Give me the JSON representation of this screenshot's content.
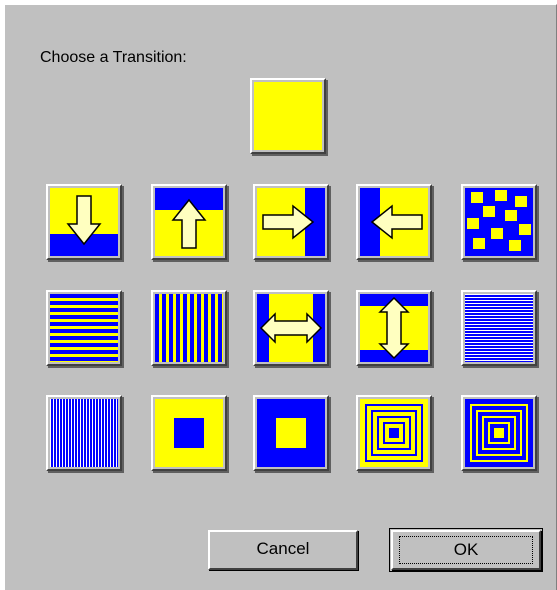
{
  "dialog": {
    "prompt": "Choose a Transition:",
    "cancel_label": "Cancel",
    "ok_label": "OK"
  },
  "colors": {
    "yellow": "#ffff00",
    "blue": "#0000ff",
    "face": "#c0c0c0"
  },
  "transitions": [
    {
      "icon": "solid-yellow-icon"
    },
    {
      "icon": "wipe-down-icon"
    },
    {
      "icon": "wipe-up-icon"
    },
    {
      "icon": "wipe-right-icon"
    },
    {
      "icon": "wipe-left-icon"
    },
    {
      "icon": "random-squares-icon"
    },
    {
      "icon": "horizontal-blinds-icon"
    },
    {
      "icon": "vertical-blinds-icon"
    },
    {
      "icon": "split-horizontal-out-icon"
    },
    {
      "icon": "split-vertical-out-icon"
    },
    {
      "icon": "fine-horizontal-lines-icon"
    },
    {
      "icon": "fine-vertical-lines-icon"
    },
    {
      "icon": "box-in-icon"
    },
    {
      "icon": "box-out-icon"
    },
    {
      "icon": "concentric-squares-in-icon"
    },
    {
      "icon": "concentric-squares-out-icon"
    }
  ]
}
